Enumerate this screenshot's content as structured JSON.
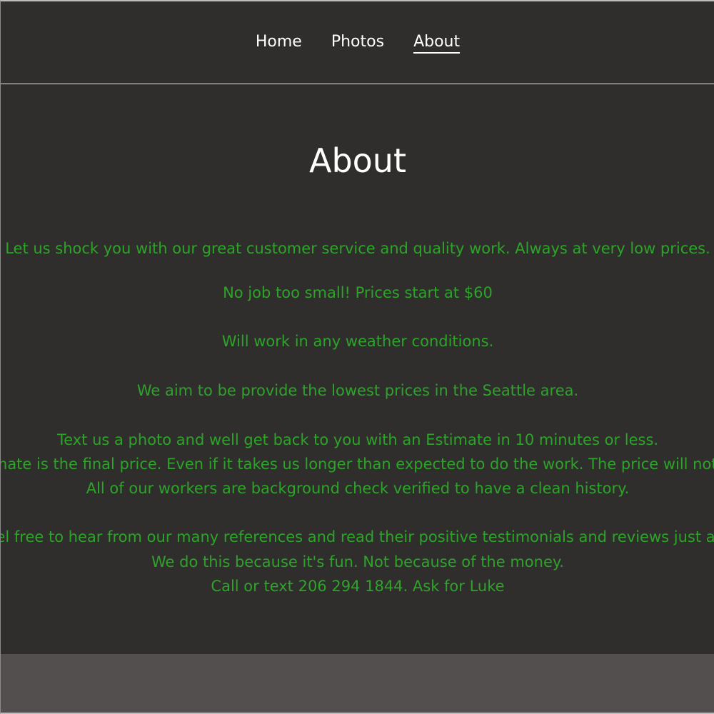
{
  "nav": {
    "items": [
      {
        "label": "Home"
      },
      {
        "label": "Photos"
      },
      {
        "label": "About"
      }
    ],
    "active": "About"
  },
  "page": {
    "title": "About"
  },
  "content": {
    "lines": [
      "Let us shock you with our great customer service and quality work. Always at very low prices.",
      "No job too small! Prices start at $60",
      "Will work in any weather conditions.",
      "We aim to be provide the lowest prices in the Seattle area.",
      "Text us a photo and well get back to you with an Estimate in 10 minutes or less.",
      "Our estimate is the final price. Even if it takes us longer than expected to do the work. The price will not change.",
      "All of our workers are background check verified to have a clean history.",
      "Feel free to hear from our many references and read their positive testimonials and reviews just ask.",
      "We do this because it's fun. Not because of the money.",
      "Call or text 206 294 1844. Ask for Luke"
    ]
  },
  "colors": {
    "background": "#2f2e2d",
    "text_green": "#2ea32a",
    "footer": "#534f4e"
  }
}
